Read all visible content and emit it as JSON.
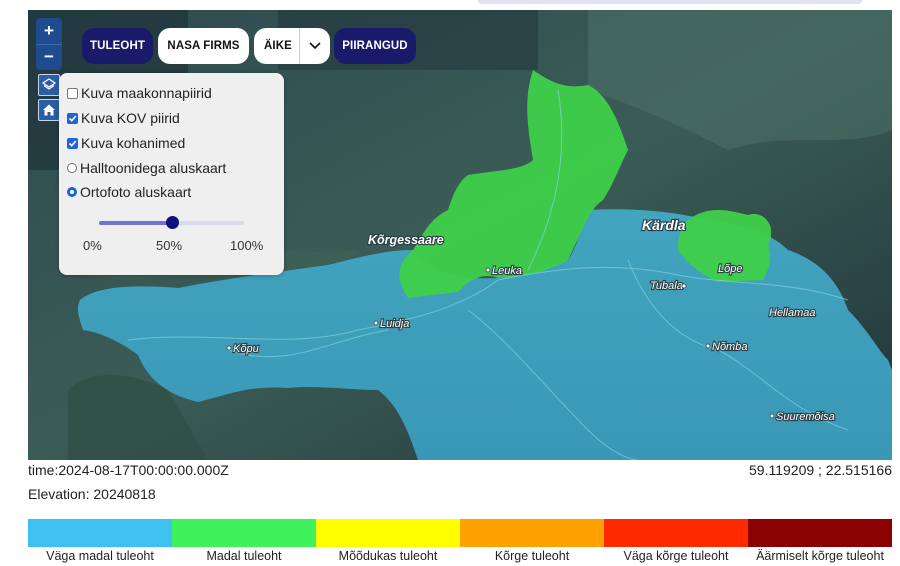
{
  "map": {
    "controls": {
      "zoom_in": "+",
      "zoom_out": "−"
    },
    "toolbar": {
      "fire_risk": "TULEOHT",
      "nasa_firms": "NASA FIRMS",
      "time_select": "ÄIKE",
      "boundaries": "PIIRANGUD"
    },
    "place_labels": {
      "korgessaare": "Kõrgessaare",
      "kardla": "Kärdla",
      "leuka": "Leuka",
      "lope": "Lõpe",
      "tubala": "Tubala",
      "luidja": "Luidja",
      "kopu": "Kõpu",
      "hellamaa": "Hellamaa",
      "nomba": "Nõmba",
      "suuremoisa": "Suuremõisa"
    }
  },
  "layers_panel": {
    "show_counties": "Kuva maakonnapiirid",
    "show_municipalities": "Kuva KOV piirid",
    "show_place_names": "Kuva kohanimed",
    "grayscale_basemap": "Halltoonidega aluskaart",
    "orthophoto_basemap": "Ortofoto aluskaart",
    "opacity": {
      "value_percent": 50,
      "min_label": "0%",
      "mid_label": "50%",
      "max_label": "100%"
    }
  },
  "info": {
    "time": "time:2024-08-17T00:00:00.000Z",
    "elevation": "Elevation: 20240818",
    "coordinates": "59.119209 ; 22.515166"
  },
  "legend": [
    {
      "label": "Väga madal tuleoht",
      "color": "#3ec1ef"
    },
    {
      "label": "Madal tuleoht",
      "color": "#3df25a"
    },
    {
      "label": "Mõõdukas tuleoht",
      "color": "#ffff00"
    },
    {
      "label": "Kõrge tuleoht",
      "color": "#ffa200"
    },
    {
      "label": "Väga kõrge tuleoht",
      "color": "#ff2a00"
    },
    {
      "label": "Äärmiselt kõrge tuleoht",
      "color": "#8b0000"
    }
  ],
  "colors": {
    "toolbar_dark": "#1a1a6b",
    "zone_very_low": "#3ea6c8",
    "zone_low": "#3fd04a",
    "checkbox_accent": "#1f64d6"
  }
}
